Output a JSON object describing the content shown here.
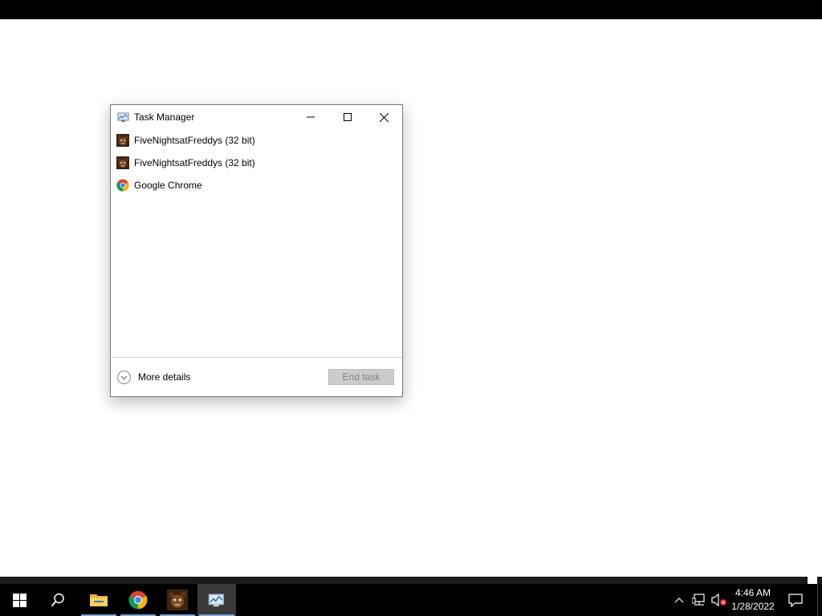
{
  "window": {
    "title": "Task Manager",
    "processes": [
      {
        "label": "FiveNightsatFreddys (32 bit)",
        "icon": "freddy-icon"
      },
      {
        "label": "FiveNightsatFreddys (32 bit)",
        "icon": "freddy-icon"
      },
      {
        "label": "Google Chrome",
        "icon": "chrome-icon"
      }
    ],
    "more_details_label": "More details",
    "end_task_label": "End task"
  },
  "taskbar": {
    "items": [
      {
        "name": "start-button",
        "icon": "windows-logo-icon"
      },
      {
        "name": "search-button",
        "icon": "search-icon"
      },
      {
        "name": "file-explorer",
        "icon": "folder-icon"
      },
      {
        "name": "google-chrome",
        "icon": "chrome-icon"
      },
      {
        "name": "five-nights-at-freddys",
        "icon": "freddy-icon"
      },
      {
        "name": "task-manager",
        "icon": "task-manager-icon"
      }
    ],
    "tray": {
      "icons": [
        "chevron-up-icon",
        "network-icon",
        "volume-muted-icon"
      ],
      "time": "4:46 AM",
      "date": "1/28/2022"
    }
  },
  "colors": {
    "taskbar_bg": "#000000",
    "active_indicator": "#7aa7d9",
    "end_task_disabled_bg": "#cccccc"
  }
}
